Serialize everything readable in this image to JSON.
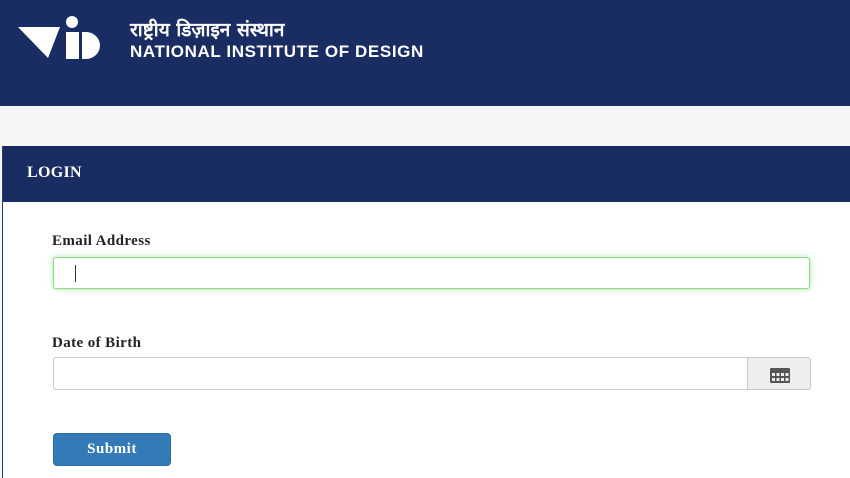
{
  "header": {
    "title_hindi": "राष्ट्रीय डिज़ाइन संस्थान",
    "title_english": "NATIONAL INSTITUTE OF DESIGN",
    "background": "#1a2d63"
  },
  "login_panel": {
    "title": "LOGIN",
    "email": {
      "label": "Email Address",
      "value": ""
    },
    "dob": {
      "label": "Date of Birth",
      "value": "",
      "icon": "calendar-icon"
    },
    "submit_label": "Submit"
  },
  "colors": {
    "accent": "#337ab7",
    "focus": "#8cdc7f"
  }
}
